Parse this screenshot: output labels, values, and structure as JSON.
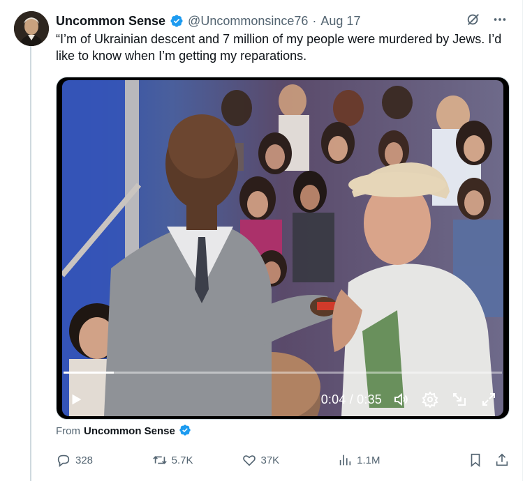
{
  "tweet": {
    "display_name": "Uncommon Sense",
    "handle": "@Uncommonsince76",
    "separator": "·",
    "date": "Aug 17",
    "text": "“I’m of Ukrainian descent and 7 million of my people were murdered by Jews. I’d like to know when I’m getting my reparations."
  },
  "video": {
    "current_time": "0:04",
    "duration": "0:35",
    "time_display": "0:04 / 0:35",
    "progress_fraction": 0.114
  },
  "attribution": {
    "from_label": "From",
    "from_name": "Uncommon Sense"
  },
  "actions": {
    "replies": "328",
    "retweets": "5.7K",
    "likes": "37K",
    "views": "1.1M"
  },
  "colors": {
    "verified_blue": "#1d9bf0",
    "secondary_text": "#536471",
    "primary_text": "#0f1419"
  },
  "icons": [
    "verified-badge-icon",
    "grok-icon",
    "more-icon",
    "play-icon",
    "volume-icon",
    "settings-icon",
    "fullscreen-icon",
    "exit-icon",
    "reply-icon",
    "retweet-icon",
    "like-icon",
    "views-icon",
    "bookmark-icon",
    "share-icon"
  ]
}
